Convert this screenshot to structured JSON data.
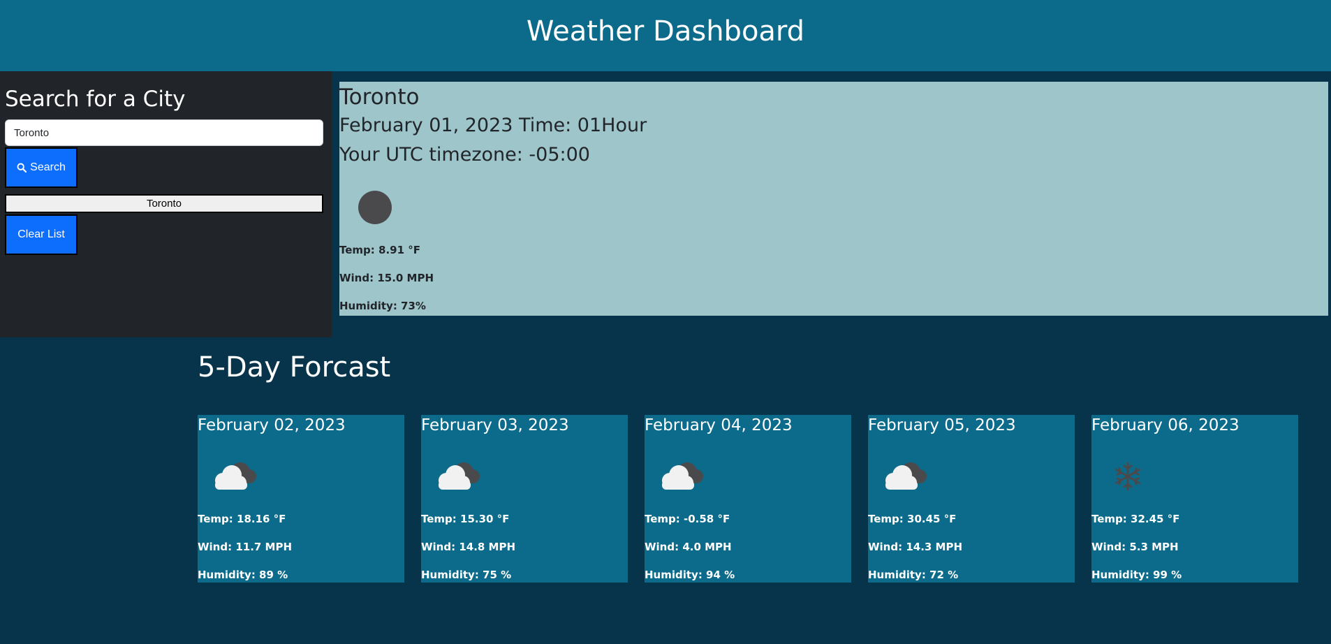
{
  "header": {
    "title": "Weather Dashboard"
  },
  "sidebar": {
    "title": "Search for a City",
    "search_value": "Toronto",
    "search_button_label": "Search",
    "history": [
      "Toronto"
    ],
    "clear_button_label": "Clear List"
  },
  "current": {
    "city": "Toronto",
    "datetime": "February 01, 2023 Time: 01Hour",
    "timezone": "Your UTC timezone: -05:00",
    "icon": "night-clear-icon",
    "temp": "Temp: 8.91 °F",
    "wind": "Wind: 15.0 MPH",
    "humidity": "Humidity: 73%"
  },
  "forecast": {
    "title": "5-Day Forcast",
    "days": [
      {
        "date": "February 02, 2023",
        "icon": "cloudy-icon",
        "temp": "Temp: 18.16 °F",
        "wind": "Wind: 11.7 MPH",
        "humidity": "Humidity: 89 %"
      },
      {
        "date": "February 03, 2023",
        "icon": "cloudy-icon",
        "temp": "Temp: 15.30 °F",
        "wind": "Wind: 14.8 MPH",
        "humidity": "Humidity: 75 %"
      },
      {
        "date": "February 04, 2023",
        "icon": "cloudy-icon",
        "temp": "Temp: -0.58 °F",
        "wind": "Wind: 4.0 MPH",
        "humidity": "Humidity: 94 %"
      },
      {
        "date": "February 05, 2023",
        "icon": "cloudy-icon",
        "temp": "Temp: 30.45 °F",
        "wind": "Wind: 14.3 MPH",
        "humidity": "Humidity: 72 %"
      },
      {
        "date": "February 06, 2023",
        "icon": "snow-icon",
        "temp": "Temp: 32.45 °F",
        "wind": "Wind: 5.3 MPH",
        "humidity": "Humidity: 99 %"
      }
    ]
  },
  "colors": {
    "header_bg": "#0c6b8b",
    "page_bg": "#07344b",
    "sidebar_bg": "#212529",
    "current_bg": "#9dc5ca",
    "button_blue": "#0d6efd",
    "card_bg": "#0c6b8b"
  }
}
